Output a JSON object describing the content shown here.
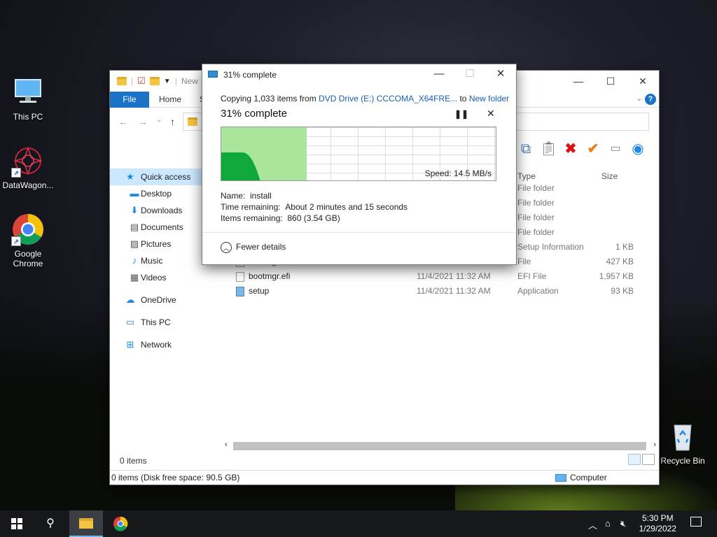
{
  "desktop": {
    "icons": [
      {
        "label": "This PC"
      },
      {
        "label": "DataWagon..."
      },
      {
        "label": "Google Chrome"
      },
      {
        "label": "Recycle Bin"
      }
    ]
  },
  "explorer": {
    "title_partial": "New",
    "tabs": {
      "file": "File",
      "home": "Home",
      "share_partial": "S"
    },
    "help": "?",
    "sidebar": {
      "quick_access": "Quick access",
      "items": [
        "Desktop",
        "Downloads",
        "Documents",
        "Pictures",
        "Music",
        "Videos"
      ],
      "onedrive": "OneDrive",
      "this_pc": "This PC",
      "network": "Network"
    },
    "columns": {
      "type": "Type",
      "size": "Size"
    },
    "rows": [
      {
        "name": "",
        "date": "",
        "type": "File folder",
        "size": ""
      },
      {
        "name": "",
        "date": "",
        "type": "File folder",
        "size": ""
      },
      {
        "name": "",
        "date": "",
        "type": "File folder",
        "size": ""
      },
      {
        "name": "",
        "date": "",
        "type": "File folder",
        "size": ""
      },
      {
        "name": "",
        "date": "",
        "type": "Setup Information",
        "size": "1 KB"
      },
      {
        "name": "bootmgr",
        "date": "11/4/2021 11:32 AM",
        "type": "File",
        "size": "427 KB"
      },
      {
        "name": "bootmgr.efi",
        "date": "11/4/2021 11:32 AM",
        "type": "EFI File",
        "size": "1,957 KB"
      },
      {
        "name": "setup",
        "date": "11/4/2021 11:32 AM",
        "type": "Application",
        "size": "93 KB"
      }
    ],
    "status_items": "0 items",
    "status_bar": "0 items (Disk free space: 90.5 GB)",
    "status_location": "Computer"
  },
  "dialog": {
    "title": "31% complete",
    "copy_prefix": "Copying 1,033 items from",
    "source": "DVD Drive (E:) CCCOMA_X64FRE...",
    "to": "to",
    "destination": "New folder",
    "percent_label": "31% complete",
    "progress": 0.31,
    "speed": "Speed: 14.5 MB/s",
    "name_label": "Name:",
    "name_value": "install",
    "time_label": "Time remaining:",
    "time_value": "About 2 minutes and 15 seconds",
    "items_label": "Items remaining:",
    "items_value": "860 (3.54 GB)",
    "fewer_details": "Fewer details"
  },
  "taskbar": {
    "time": "5:30 PM",
    "date": "1/29/2022"
  },
  "colors": {
    "accent": "#1a73c7",
    "progress_fill": "#a9e59a",
    "speed_fill": "#10a83a"
  }
}
